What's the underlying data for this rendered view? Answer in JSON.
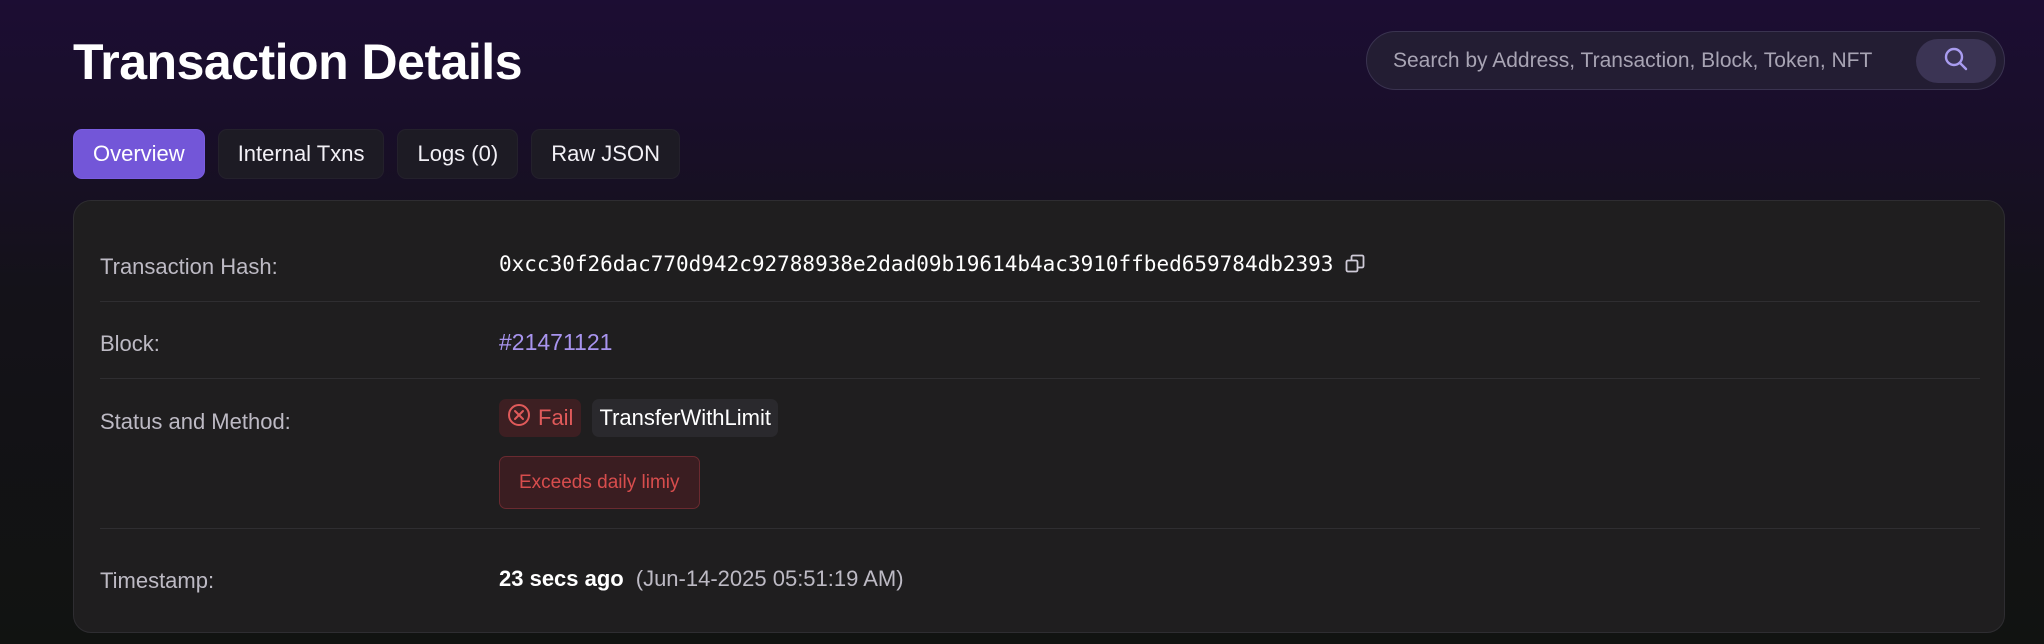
{
  "header": {
    "title": "Transaction Details"
  },
  "search": {
    "placeholder": "Search by Address, Transaction, Block, Token, NFT",
    "button_icon": "search-icon"
  },
  "tabs": [
    {
      "label": "Overview",
      "active": true
    },
    {
      "label": "Internal Txns",
      "active": false
    },
    {
      "label": "Logs (0)",
      "active": false
    },
    {
      "label": "Raw JSON",
      "active": false
    }
  ],
  "details": {
    "hash": {
      "label": "Transaction Hash:",
      "value": "0xcc30f26dac770d942c92788938e2dad09b19614b4ac3910ffbed659784db2393",
      "copy_icon": "copy-icon"
    },
    "block": {
      "label": "Block:",
      "value": "#21471121"
    },
    "status": {
      "label": "Status and Method:",
      "status_text": "Fail",
      "status_icon": "x-circle-icon",
      "method": "TransferWithLimit",
      "error_message": "Exceeds daily limiy"
    },
    "timestamp": {
      "label": "Timestamp:",
      "relative": "23 secs ago",
      "absolute": "(Jun-14-2025 05:51:19 AM)"
    }
  },
  "colors": {
    "accent": "#7356d8",
    "link": "#a894ee",
    "error": "#e05a5a"
  }
}
